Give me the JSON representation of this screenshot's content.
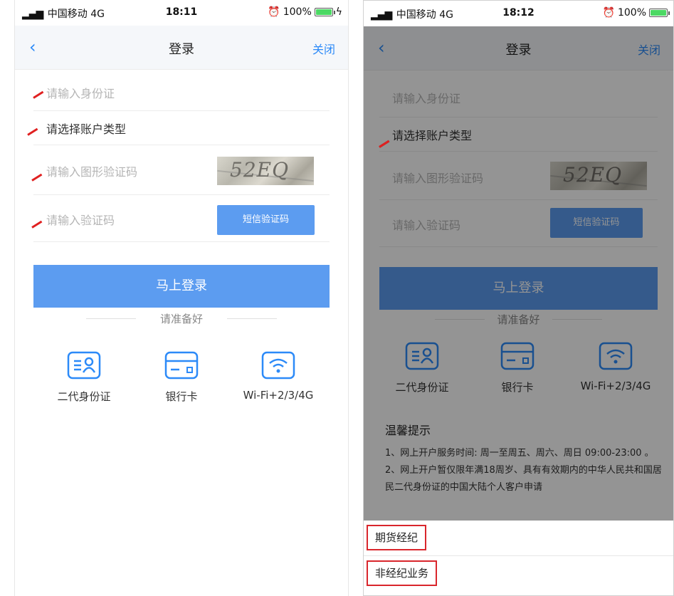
{
  "colors": {
    "accent": "#2c8af8",
    "button": "#5c9cf0",
    "annotation": "#e02020"
  },
  "left": {
    "status": {
      "bars": "▂▄▆",
      "carrier": "中国移动",
      "network": "4G",
      "time": "18:11",
      "battery": "100%"
    },
    "nav": {
      "back": "‹",
      "title": "登录",
      "close": "关闭"
    },
    "fields": {
      "id_placeholder": "请输入身份证",
      "account_type": "请选择账户类型",
      "captcha_placeholder": "请输入图形验证码",
      "sms_placeholder": "请输入验证码",
      "sms_button": "短信验证码"
    },
    "captcha_text": "52EQ",
    "login_button": "马上登录",
    "prep_title": "请准备好",
    "requirements": [
      {
        "icon": "id-card-icon",
        "label": "二代身份证"
      },
      {
        "icon": "bank-card-icon",
        "label": "银行卡"
      },
      {
        "icon": "wifi-icon",
        "label": "Wi-Fi+2/3/4G"
      }
    ]
  },
  "right": {
    "status": {
      "bars": "▂▄▆",
      "carrier": "中国移动",
      "network": "4G",
      "time": "18:12",
      "battery": "100%"
    },
    "nav": {
      "back": "‹",
      "title": "登录",
      "close": "关闭"
    },
    "fields": {
      "id_placeholder": "请输入身份证",
      "account_type": "请选择账户类型",
      "captcha_placeholder": "请输入图形验证码",
      "sms_placeholder": "请输入验证码",
      "sms_button": "短信验证码"
    },
    "captcha_text": "52EQ",
    "login_button": "马上登录",
    "prep_title": "请准备好",
    "requirements": [
      {
        "icon": "id-card-icon",
        "label": "二代身份证"
      },
      {
        "icon": "bank-card-icon",
        "label": "银行卡"
      },
      {
        "icon": "wifi-icon",
        "label": "Wi-Fi+2/3/4G"
      }
    ],
    "tips": {
      "title": "温馨提示",
      "line1": "1、网上开户服务时间: 周一至周五、周六、周日 09:00-23:00 。",
      "line2": "2、网上开户暂仅限年满18周岁、具有有效期内的中华人民共和国居民二代身份证的中国大陆个人客户申请"
    },
    "sheet_options": [
      "期货经纪",
      "非经纪业务"
    ]
  }
}
